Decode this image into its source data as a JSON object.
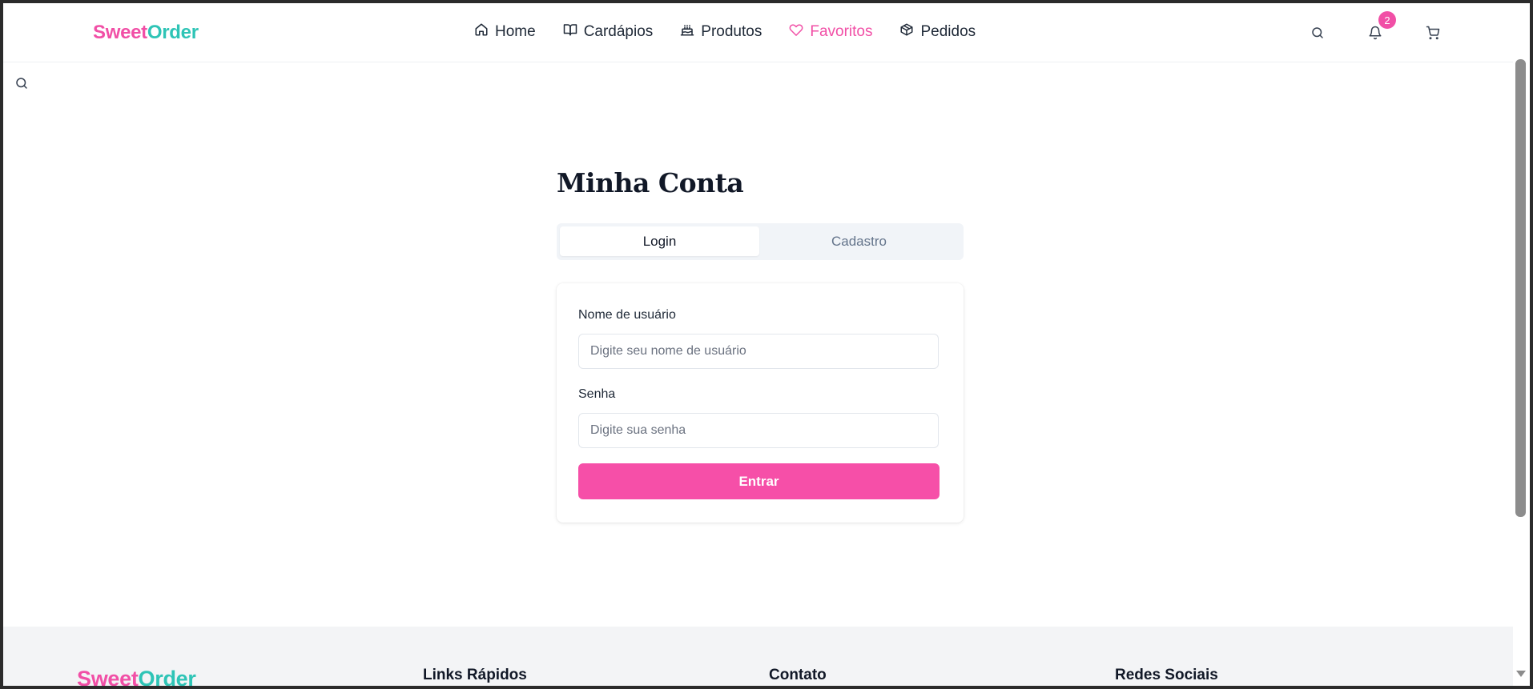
{
  "app": {
    "logo_part1": "Sweet",
    "logo_part2": "Order"
  },
  "nav": {
    "items": [
      {
        "label": "Home",
        "icon": "home-icon"
      },
      {
        "label": "Cardápios",
        "icon": "book-icon"
      },
      {
        "label": "Produtos",
        "icon": "cake-icon"
      },
      {
        "label": "Favoritos",
        "icon": "heart-icon",
        "active": true
      },
      {
        "label": "Pedidos",
        "icon": "package-icon"
      }
    ]
  },
  "header": {
    "notification_count": "2",
    "icons": [
      "search-icon",
      "bell-icon",
      "cart-icon"
    ]
  },
  "page": {
    "title": "Minha Conta",
    "tabs": {
      "login": "Login",
      "register": "Cadastro"
    }
  },
  "form": {
    "username_label": "Nome de usuário",
    "username_placeholder": "Digite seu nome de usuário",
    "password_label": "Senha",
    "password_placeholder": "Digite sua senha",
    "submit_label": "Entrar"
  },
  "footer": {
    "logo_part1": "Sweet",
    "logo_part2": "Order",
    "quick_links": "Links Rápidos",
    "contact": "Contato",
    "social": "Redes Sociais"
  },
  "colors": {
    "brand_pink": "#f14fa6",
    "brand_teal": "#2ec4b6",
    "button": "#f64fa8"
  }
}
